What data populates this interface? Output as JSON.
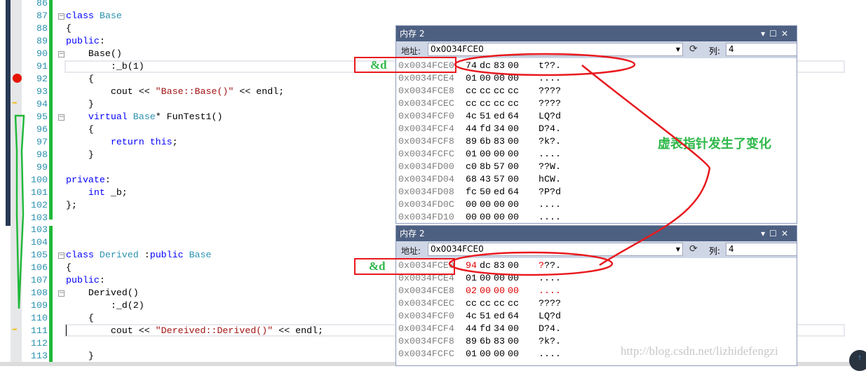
{
  "editor": {
    "top_lines": [
      {
        "n": "86",
        "tokens": []
      },
      {
        "n": "87",
        "fold": true,
        "tokens": [
          [
            "class ",
            "kw"
          ],
          [
            "Base",
            "ty"
          ]
        ]
      },
      {
        "n": "88",
        "tokens": [
          [
            "{",
            "pl"
          ]
        ]
      },
      {
        "n": "89",
        "tokens": [
          [
            "public",
            "kw"
          ],
          [
            ":",
            "pl"
          ]
        ]
      },
      {
        "n": "90",
        "fold": true,
        "tokens": [
          [
            "    Base()",
            "pl"
          ]
        ]
      },
      {
        "n": "91",
        "tokens": [
          [
            "        :_b(1)",
            "pl"
          ]
        ]
      },
      {
        "n": "92",
        "tokens": [
          [
            "    {",
            "pl"
          ]
        ]
      },
      {
        "n": "93",
        "tokens": [
          [
            "        cout << ",
            "pl"
          ],
          [
            "\"Base::Base()\"",
            "st"
          ],
          [
            " << endl;",
            "pl"
          ]
        ]
      },
      {
        "n": "94",
        "tokens": [
          [
            "    }",
            "pl"
          ]
        ]
      },
      {
        "n": "95",
        "fold": true,
        "tokens": [
          [
            "    ",
            "pl"
          ],
          [
            "virtual ",
            "kw"
          ],
          [
            "Base",
            "ty"
          ],
          [
            "* FunTest1()",
            "pl"
          ]
        ]
      },
      {
        "n": "96",
        "tokens": [
          [
            "    {",
            "pl"
          ]
        ]
      },
      {
        "n": "97",
        "tokens": [
          [
            "        ",
            "pl"
          ],
          [
            "return this",
            "kw"
          ],
          [
            ";",
            "pl"
          ]
        ]
      },
      {
        "n": "98",
        "tokens": [
          [
            "    }",
            "pl"
          ]
        ]
      },
      {
        "n": "99",
        "tokens": []
      },
      {
        "n": "100",
        "tokens": [
          [
            "private",
            "kw"
          ],
          [
            ":",
            "pl"
          ]
        ]
      },
      {
        "n": "101",
        "tokens": [
          [
            "    ",
            "pl"
          ],
          [
            "int ",
            "kw"
          ],
          [
            "_b;",
            "pl"
          ]
        ]
      },
      {
        "n": "102",
        "tokens": [
          [
            "};",
            "pl"
          ]
        ]
      },
      {
        "n": "103",
        "tokens": []
      }
    ],
    "bottom_lines": [
      {
        "n": "103",
        "tokens": []
      },
      {
        "n": "104",
        "tokens": []
      },
      {
        "n": "105",
        "fold": true,
        "tokens": [
          [
            "class ",
            "kw"
          ],
          [
            "Derived",
            "ty"
          ],
          [
            " :",
            "pl"
          ],
          [
            "public ",
            "kw"
          ],
          [
            "Base",
            "ty"
          ]
        ]
      },
      {
        "n": "106",
        "tokens": [
          [
            "{",
            "pl"
          ]
        ]
      },
      {
        "n": "107",
        "tokens": [
          [
            "public",
            "kw"
          ],
          [
            ":",
            "pl"
          ]
        ]
      },
      {
        "n": "108",
        "fold": true,
        "tokens": [
          [
            "    Derived()",
            "pl"
          ]
        ]
      },
      {
        "n": "109",
        "tokens": [
          [
            "        :_d(2)",
            "pl"
          ]
        ]
      },
      {
        "n": "110",
        "tokens": [
          [
            "    {",
            "pl"
          ]
        ]
      },
      {
        "n": "111",
        "tokens": [
          [
            "        cout << ",
            "pl"
          ],
          [
            "\"Dereived::Derived()\"",
            "st"
          ],
          [
            " << endl;",
            "pl"
          ]
        ]
      },
      {
        "n": "112",
        "tokens": []
      },
      {
        "n": "113",
        "tokens": [
          [
            "    }",
            "pl"
          ]
        ]
      }
    ]
  },
  "memory_windows": [
    {
      "title": "内存 2",
      "address_label": "地址:",
      "address": "0x0034FCE0",
      "columns_label": "列:",
      "columns": "4",
      "rows": [
        {
          "addr": "0x0034FCE0",
          "bytes": [
            "74",
            "dc",
            "83",
            "00"
          ],
          "ascii": "t??."
        },
        {
          "addr": "0x0034FCE4",
          "bytes": [
            "01",
            "00",
            "00",
            "00"
          ],
          "ascii": "...."
        },
        {
          "addr": "0x0034FCE8",
          "bytes": [
            "cc",
            "cc",
            "cc",
            "cc"
          ],
          "ascii": "????"
        },
        {
          "addr": "0x0034FCEC",
          "bytes": [
            "cc",
            "cc",
            "cc",
            "cc"
          ],
          "ascii": "????"
        },
        {
          "addr": "0x0034FCF0",
          "bytes": [
            "4c",
            "51",
            "ed",
            "64"
          ],
          "ascii": "LQ?d"
        },
        {
          "addr": "0x0034FCF4",
          "bytes": [
            "44",
            "fd",
            "34",
            "00"
          ],
          "ascii": "D?4."
        },
        {
          "addr": "0x0034FCF8",
          "bytes": [
            "89",
            "6b",
            "83",
            "00"
          ],
          "ascii": "?k?."
        },
        {
          "addr": "0x0034FCFC",
          "bytes": [
            "01",
            "00",
            "00",
            "00"
          ],
          "ascii": "...."
        },
        {
          "addr": "0x0034FD00",
          "bytes": [
            "c0",
            "8b",
            "57",
            "00"
          ],
          "ascii": "??W."
        },
        {
          "addr": "0x0034FD04",
          "bytes": [
            "68",
            "43",
            "57",
            "00"
          ],
          "ascii": "hCW."
        },
        {
          "addr": "0x0034FD08",
          "bytes": [
            "fc",
            "50",
            "ed",
            "64"
          ],
          "ascii": "?P?d"
        },
        {
          "addr": "0x0034FD0C",
          "bytes": [
            "00",
            "00",
            "00",
            "00"
          ],
          "ascii": "...."
        },
        {
          "addr": "0x0034FD10",
          "bytes": [
            "00",
            "00",
            "00",
            "00"
          ],
          "ascii": "...."
        }
      ]
    },
    {
      "title": "内存 2",
      "address_label": "地址:",
      "address": "0x0034FCE0",
      "columns_label": "列:",
      "columns": "4",
      "rows": [
        {
          "addr": "0x0034FCE0",
          "bytes": [
            "94",
            "dc",
            "83",
            "00"
          ],
          "ascii": "???.",
          "changed_bytes": [
            0
          ],
          "changed_ascii": true
        },
        {
          "addr": "0x0034FCE4",
          "bytes": [
            "01",
            "00",
            "00",
            "00"
          ],
          "ascii": "...."
        },
        {
          "addr": "0x0034FCE8",
          "bytes": [
            "02",
            "00",
            "00",
            "00"
          ],
          "ascii": "....",
          "changed_bytes": [
            0,
            1,
            2,
            3
          ],
          "changed_ascii": true
        },
        {
          "addr": "0x0034FCEC",
          "bytes": [
            "cc",
            "cc",
            "cc",
            "cc"
          ],
          "ascii": "????"
        },
        {
          "addr": "0x0034FCF0",
          "bytes": [
            "4c",
            "51",
            "ed",
            "64"
          ],
          "ascii": "LQ?d"
        },
        {
          "addr": "0x0034FCF4",
          "bytes": [
            "44",
            "fd",
            "34",
            "00"
          ],
          "ascii": "D?4."
        },
        {
          "addr": "0x0034FCF8",
          "bytes": [
            "89",
            "6b",
            "83",
            "00"
          ],
          "ascii": "?k?."
        },
        {
          "addr": "0x0034FCFC",
          "bytes": [
            "01",
            "00",
            "00",
            "00"
          ],
          "ascii": "...."
        }
      ]
    }
  ],
  "annotations": {
    "amp_label": "&d",
    "note": "虚表指针发生了变化",
    "note_color": "#2fb84a",
    "mark_color": "#e8191e"
  },
  "watermark": "http://blog.csdn.net/lizhidefengzi",
  "colors": {
    "keyword": "#0000ff",
    "type": "#2b91af",
    "string": "#a31515",
    "changed": "#e00000",
    "title_bar": "#4d6082"
  }
}
